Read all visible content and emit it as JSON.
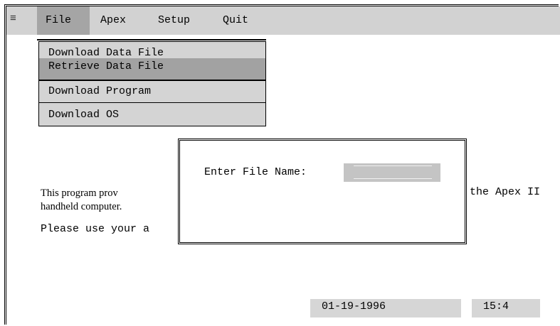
{
  "menubar": {
    "system_icon": "≡",
    "items": [
      "File",
      "Apex",
      "Setup",
      "Quit"
    ]
  },
  "file_menu": {
    "items": [
      "Download Data File",
      "Retrieve Data File",
      "Download Program",
      "Download OS"
    ]
  },
  "dialog": {
    "label": "Enter File Name:",
    "value": ""
  },
  "body": {
    "line1_left": "This program prov",
    "line1_right": "the Apex II",
    "line2": "handheld computer.",
    "line3": "Please use your a"
  },
  "status": {
    "date": "01-19-1996",
    "time": "15:4"
  },
  "colors": {
    "menubar": "#d2d2d2",
    "menu_active": "#a5a5a5",
    "menu_item": "#d4d4d4",
    "menu_selected": "#a2a2a2",
    "status": "#d6d6d6"
  }
}
